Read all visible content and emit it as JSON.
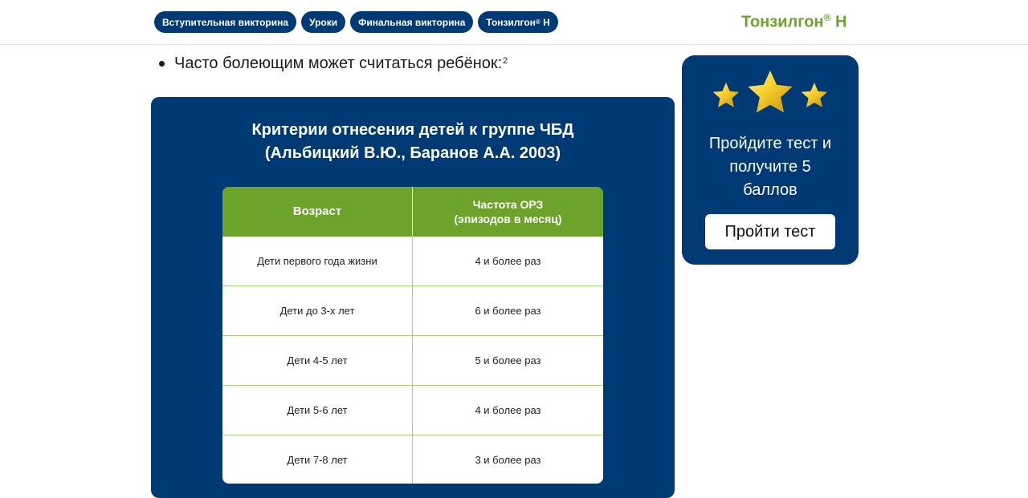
{
  "nav": {
    "items": [
      {
        "label": "Вступительная викторина"
      },
      {
        "label": "Уроки"
      },
      {
        "label": "Финальная викторина"
      },
      {
        "label": "Тонзилгон",
        "sup": "®",
        "suffix": " Н"
      }
    ]
  },
  "brand": {
    "name": "Тонзилгон",
    "sup": "®",
    "suffix": " Н"
  },
  "content": {
    "bullet_text": "Часто болеющим может считаться ребёнок:",
    "bullet_sup": "2"
  },
  "card": {
    "title_line1": "Критерии отнесения детей к группе ЧБД",
    "title_line2": "(Альбицкий В.Ю., Баранов А.А. 2003)",
    "table": {
      "headers": {
        "age": "Возраст",
        "freq_line1": "Частота ОРЗ",
        "freq_line2": "(эпизодов в месяц)"
      },
      "rows": [
        {
          "age": "Дети первого года жизни",
          "freq": "4 и более раз"
        },
        {
          "age": "Дети до 3-х лет",
          "freq": "6 и более раз"
        },
        {
          "age": "Дети 4-5 лет",
          "freq": "5 и более раз"
        },
        {
          "age": "Дети 5-6 лет",
          "freq": "4 и более раз"
        },
        {
          "age": "Дети 7-8 лет",
          "freq": "3 и более раз"
        }
      ]
    }
  },
  "promo": {
    "icon": "stars-icon",
    "text_line1": "Пройдите тест и",
    "text_line2": "получите 5",
    "text_line3": "баллов",
    "button_label": "Пройти тест"
  },
  "colors": {
    "navy": "#003a75",
    "green": "#6ba32b",
    "gold": "#f2c523"
  }
}
